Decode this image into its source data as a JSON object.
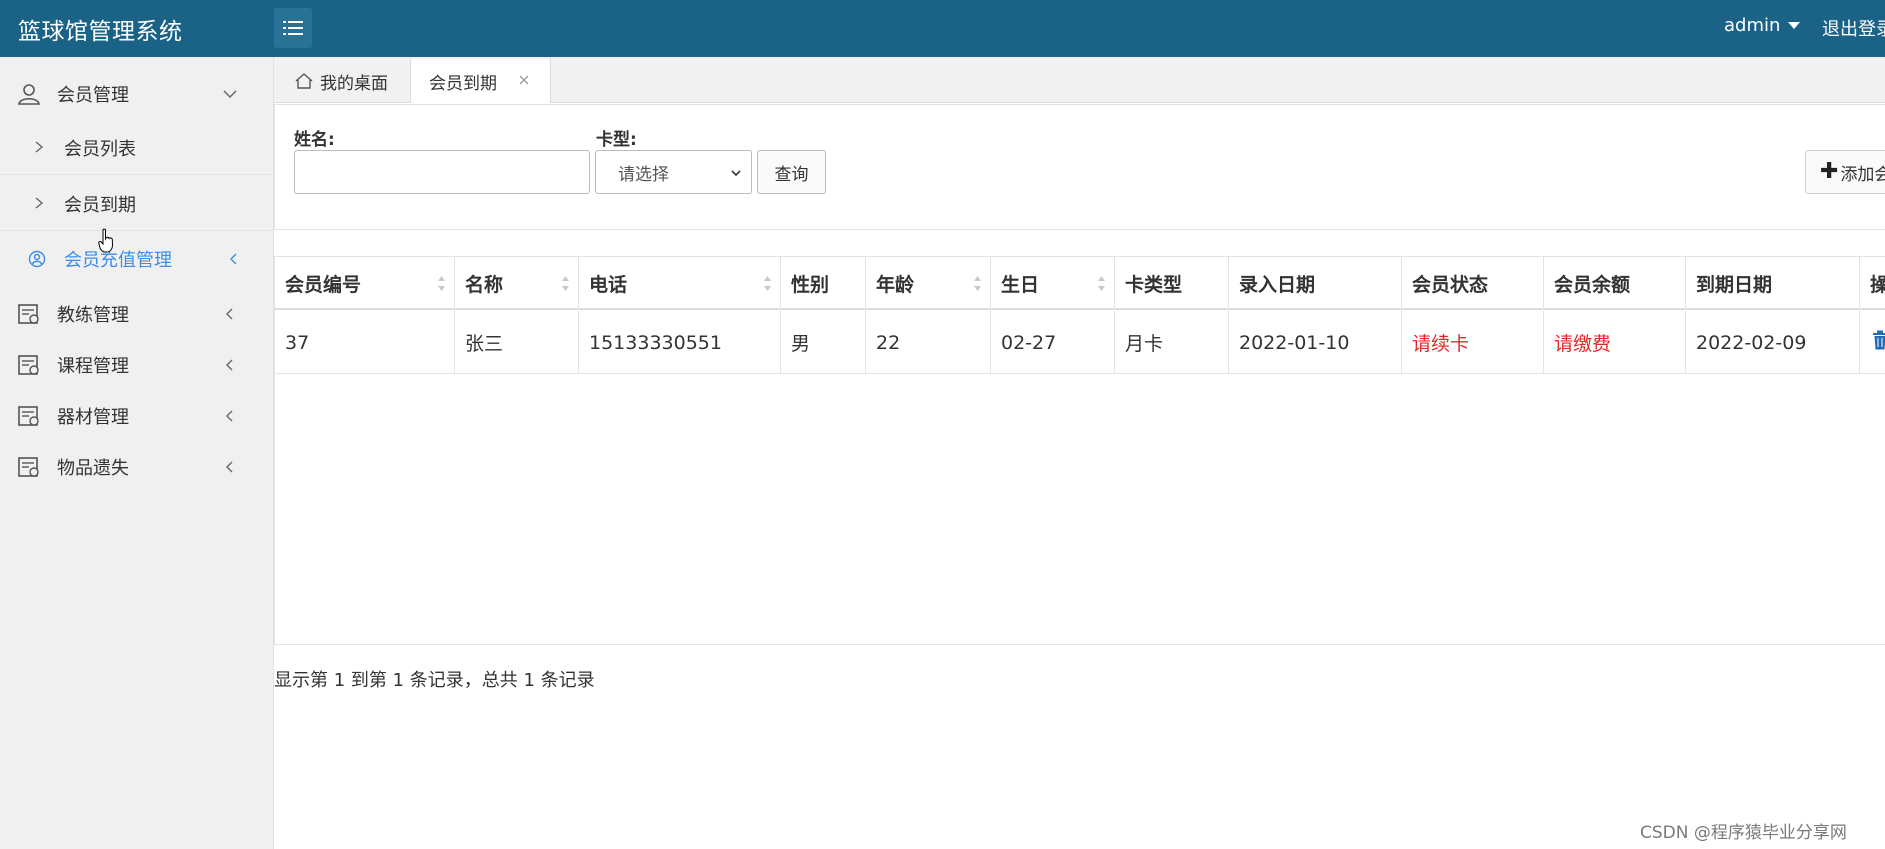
{
  "header": {
    "app_title": "篮球馆管理系统",
    "user": "admin",
    "logout": "退出登录",
    "bg_color": "#1a6286"
  },
  "sidebar": {
    "groups": [
      {
        "label": "会员管理",
        "icon": "user-icon",
        "expanded": true
      },
      {
        "label": "会员充值管理",
        "icon": "user-circle-icon",
        "active": true
      },
      {
        "label": "教练管理",
        "icon": "list-doc-icon"
      },
      {
        "label": "课程管理",
        "icon": "list-doc-icon"
      },
      {
        "label": "器材管理",
        "icon": "list-doc-icon"
      },
      {
        "label": "物品遗失",
        "icon": "list-doc-icon"
      }
    ],
    "sub_items": [
      {
        "label": "会员列表"
      },
      {
        "label": "会员到期"
      }
    ]
  },
  "tabs": [
    {
      "label": "我的桌面",
      "icon": "home-icon"
    },
    {
      "label": "会员到期",
      "active": true
    }
  ],
  "filters": {
    "name_label": "姓名:",
    "name_value": "",
    "card_label": "卡型:",
    "card_placeholder": "请选择",
    "query_button": "查询",
    "add_button": "添加会员"
  },
  "table": {
    "columns": [
      "会员编号",
      "名称",
      "电话",
      "性别",
      "年龄",
      "生日",
      "卡类型",
      "录入日期",
      "会员状态",
      "会员余额",
      "到期日期",
      "操作"
    ],
    "rows": [
      [
        "37",
        "张三",
        "15133330551",
        "男",
        "22",
        "02-27",
        "月卡",
        "2022-01-10",
        "请续卡",
        "请缴费",
        "2022-02-09",
        ""
      ]
    ],
    "alert_color": "#e02a2a"
  },
  "pagination": {
    "summary": "显示第 1 到第 1 条记录，总共 1 条记录"
  },
  "watermark": "CSDN @程序猿毕业分享网"
}
